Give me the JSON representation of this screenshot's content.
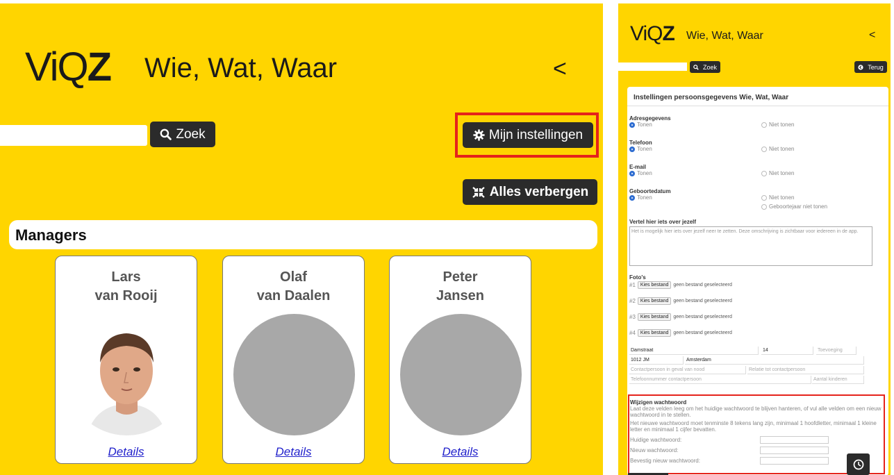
{
  "left": {
    "logo": {
      "vi": "ViQ",
      "z": "Z"
    },
    "app_title": "Wie, Wat, Waar",
    "back_label": "<",
    "search": {
      "value": "",
      "placeholder": ""
    },
    "zoek_label": "Zoek",
    "settings_label": "Mijn instellingen",
    "hide_all_label": "Alles verbergen",
    "section_title": "Managers",
    "cards": [
      {
        "first": "Lars",
        "last": "van Rooij",
        "details": "Details",
        "has_photo": true
      },
      {
        "first": "Olaf",
        "last": "van Daalen",
        "details": "Details",
        "has_photo": false
      },
      {
        "first": "Peter",
        "last": "Jansen",
        "details": "Details",
        "has_photo": false
      }
    ]
  },
  "right": {
    "logo": {
      "vi": "ViQ",
      "z": "Z"
    },
    "app_title": "Wie, Wat, Waar",
    "back_label": "<",
    "zoek_label": "Zoek",
    "terug_label": "Terug",
    "form_title": "Instellingen persoonsgegevens Wie, Wat, Waar",
    "groups": [
      {
        "label": "Adresgegevens",
        "show": "Tonen",
        "hide": "Niet tonen"
      },
      {
        "label": "Telefoon",
        "show": "Tonen",
        "hide": "Niet tonen"
      },
      {
        "label": "E-mail",
        "show": "Tonen",
        "hide": "Niet tonen"
      },
      {
        "label": "Geboortedatum",
        "show": "Tonen",
        "hide": "Niet tonen",
        "hide2": "Geboortejaar niet tonen"
      }
    ],
    "about_label": "Vertel hier iets over jezelf",
    "about_placeholder": "Het is mogelijk hier iets over jezelf neer te zetten. Deze omschrijving is zichtbaar voor iedereen in de app.",
    "photos_label": "Foto's",
    "photos": [
      {
        "num": "#1",
        "button": "Kies bestand",
        "status": "geen bestand geselecteerd"
      },
      {
        "num": "#2",
        "button": "Kies bestand",
        "status": "geen bestand geselecteerd"
      },
      {
        "num": "#3",
        "button": "Kies bestand",
        "status": "geen bestand geselecteerd"
      },
      {
        "num": "#4",
        "button": "Kies bestand",
        "status": "geen bestand geselecteerd"
      }
    ],
    "address": {
      "street": "Damstraat",
      "number": "14",
      "addition_ph": "Toevoeging",
      "postcode": "1012 JM",
      "city": "Amsterdam",
      "emergency_ph": "Contactpersoon in geval van nood",
      "relation_ph": "Relatie tot contactpersoon",
      "emergency_phone_ph": "Telefoonnummer contactpersoon",
      "children_ph": "Aantal kinderen"
    },
    "password": {
      "title": "Wijzigen wachtwoord",
      "intro": "Laat deze velden leeg om het huidige wachtwoord te blijven hanteren, of vul alle velden om een nieuw wachtwoord in te stellen.",
      "rules": "Het nieuwe wachtwoord moet tenminste 8 tekens lang zijn, minimaal 1 hoofdletter, minimaal 1 kleine letter en minimaal 1 cijfer bevatten.",
      "current_label": "Huidige wachtwoord:",
      "new_label": "Nieuw wachtwoord:",
      "confirm_label": "Bevestig nieuw wachtwoord:"
    }
  },
  "colors": {
    "brand_yellow": "#ffd500",
    "dark_button": "#2b2b2b",
    "highlight_red": "#e5231b",
    "link_blue": "#2222cc"
  },
  "icons": {
    "search": "search-icon",
    "settings": "gear-icon",
    "hide": "collapse-icon",
    "back": "chevron-left-icon",
    "terug": "circle-arrow-icon",
    "clock": "clock-icon"
  }
}
